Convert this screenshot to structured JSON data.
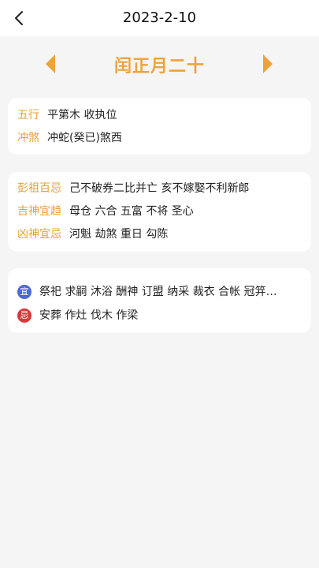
{
  "header": {
    "title": "2023-2-10"
  },
  "lunar": {
    "title": "闰正月二十"
  },
  "card1": {
    "rows": [
      {
        "label": "五行",
        "value": "平第木 收执位"
      },
      {
        "label": "冲煞",
        "value": "冲蛇(癸已)煞西"
      }
    ]
  },
  "card2": {
    "rows": [
      {
        "label": "彭祖百忌",
        "value": "己不破券二比并亡 亥不嫁娶不利新郎"
      },
      {
        "label": "吉神宜趋",
        "value": "母仓 六合 五富 不将 圣心"
      },
      {
        "label": "凶神宜忌",
        "value": "河魁 劫煞 重日 勾陈"
      }
    ]
  },
  "card3": {
    "yi": {
      "badge": "宜",
      "text": "祭祀 求嗣 沐浴 酬神 订盟 纳采 裁衣 合帐 冠笄…"
    },
    "ji": {
      "badge": "忌",
      "text": "安葬 作灶 伐木 作梁"
    }
  },
  "colors": {
    "accent": "#f0a23a",
    "label": "#e6a038",
    "yi_badge": "#4a6ad0",
    "ji_badge": "#d63a3a"
  },
  "icons": {
    "back": "chevron-left-icon",
    "prev": "triangle-left-icon",
    "next": "triangle-right-icon"
  }
}
